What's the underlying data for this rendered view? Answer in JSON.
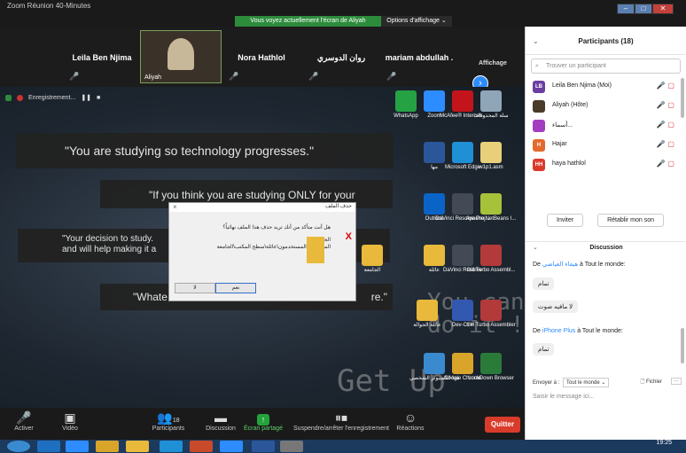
{
  "window": {
    "title": "Zoom Réunion 40-Minutes",
    "share_banner": "Vous voyez actuellement l'écran de Aliyah",
    "view_options": "Options d'affichage ⌄"
  },
  "gallery": {
    "tiles": [
      "Leila Ben Njima",
      "Aliyah",
      "Nora Hathlol",
      "روان الدوسري",
      "mariam abdullah ."
    ],
    "affichage": "Affichage",
    "next_icon": "chevron-right-icon"
  },
  "recording": {
    "label": "Enregistrement...",
    "pause": "❚❚",
    "stop": "■"
  },
  "slides": {
    "s1": "\"You are studying so technology progresses.\"",
    "s2": "\"If you think you are studying ONLY for your",
    "s3a": "\"Your decision to study.",
    "s3b": "and will help making it a",
    "s4a": "\"Whate",
    "s4b": "re.\""
  },
  "overlay": {
    "getup": "Get Up",
    "youcan1": "You can",
    "youcan2": "do it !"
  },
  "dialog": {
    "title": "حذف الملف",
    "close": "×",
    "question": "هل أنت متأكد من أنك تريد حذف هذا الملف نهائياً؟",
    "name": "الجامعة",
    "location": "الموقع: C:\\المستخدمون\\عائلة\\سطح المكتب\\الجامعة",
    "yes": "نعم",
    "no": "لا"
  },
  "desktop_icons": [
    {
      "label": "WhatsApp",
      "color": "#25a244"
    },
    {
      "label": "Zoom",
      "color": "#2d8cff"
    },
    {
      "label": "McAfee® Internet...",
      "color": "#c3141c"
    },
    {
      "label": "سلة المحذوفات",
      "color": "#8fa6b8"
    },
    {
      "label": "مها",
      "color": "#2b579a"
    },
    {
      "label": "Microsoft Edge",
      "color": "#1f8fd6"
    },
    {
      "label": "w1p1.asm",
      "color": "#e8d07a"
    },
    {
      "label": "Outlook",
      "color": "#0a64c8"
    },
    {
      "label": "DaVinci Resolve Proj...",
      "color": "#444a55"
    },
    {
      "label": "Apache NetBeans I...",
      "color": "#a6c23a"
    },
    {
      "label": "عائلة",
      "color": "#e8b93a"
    },
    {
      "label": "DaVinci Resolve",
      "color": "#444a55"
    },
    {
      "label": "Gill Turbo Assembl...",
      "color": "#b33a3a"
    },
    {
      "label": "عائلة الجوالة",
      "color": "#e8b93a"
    },
    {
      "label": "Dev-C++",
      "color": "#3358b0"
    },
    {
      "label": "Gill Turbo Assembler",
      "color": "#b33a3a"
    },
    {
      "label": "هذا الكمبيوتر الشخصي",
      "color": "#3a8ad0"
    },
    {
      "label": "Google Chrome",
      "color": "#d8a52a"
    },
    {
      "label": "LockDown Browser",
      "color": "#2a7a3a"
    },
    {
      "label": "الجامعة",
      "color": "#e8b93a"
    }
  ],
  "toolbar": {
    "activer": "Activer",
    "video": "Vidéo",
    "participants": "Participants",
    "participants_count": "18",
    "discussion": "Discussion",
    "share": "Écran partagé",
    "record": "Suspendre/arrêter l'enregistrement",
    "reactions": "Réactions",
    "quit": "Quitter"
  },
  "participants_panel": {
    "title": "Participants (18)",
    "search_placeholder": "Trouver un participant",
    "people": [
      {
        "initials": "LB",
        "name": "Leila Ben Njima (Moi)",
        "color": "#6b3fa0"
      },
      {
        "initials": "",
        "name": "Aliyah (Hôte)",
        "color": "#4a3a2a"
      },
      {
        "initials": "",
        "name": "أسماء...",
        "color": "#a33cc0"
      },
      {
        "initials": "H",
        "name": "Hajar",
        "color": "#e26a2c"
      },
      {
        "initials": "HH",
        "name": "haya hathlol",
        "color": "#d93b2b"
      }
    ],
    "invite": "Inviter",
    "reset": "Rétablir mon son"
  },
  "chat": {
    "title": "Discussion",
    "from1_pre": "De ",
    "from1_name": "هيفاء العياضي",
    "from1_post": " à Tout le monde:",
    "m1": "تمام",
    "m2": "لا مافيه صوت",
    "from2_pre": "De ",
    "from2_name": "iPhone Plus",
    "from2_post": " à Tout le monde:",
    "m3": "تمام",
    "send_to": "Envoyer à :",
    "send_target": "Tout le monde ⌄",
    "file": "Fichier",
    "more": "···",
    "placeholder": "Saisir le message ici..."
  },
  "clock": "19:25"
}
